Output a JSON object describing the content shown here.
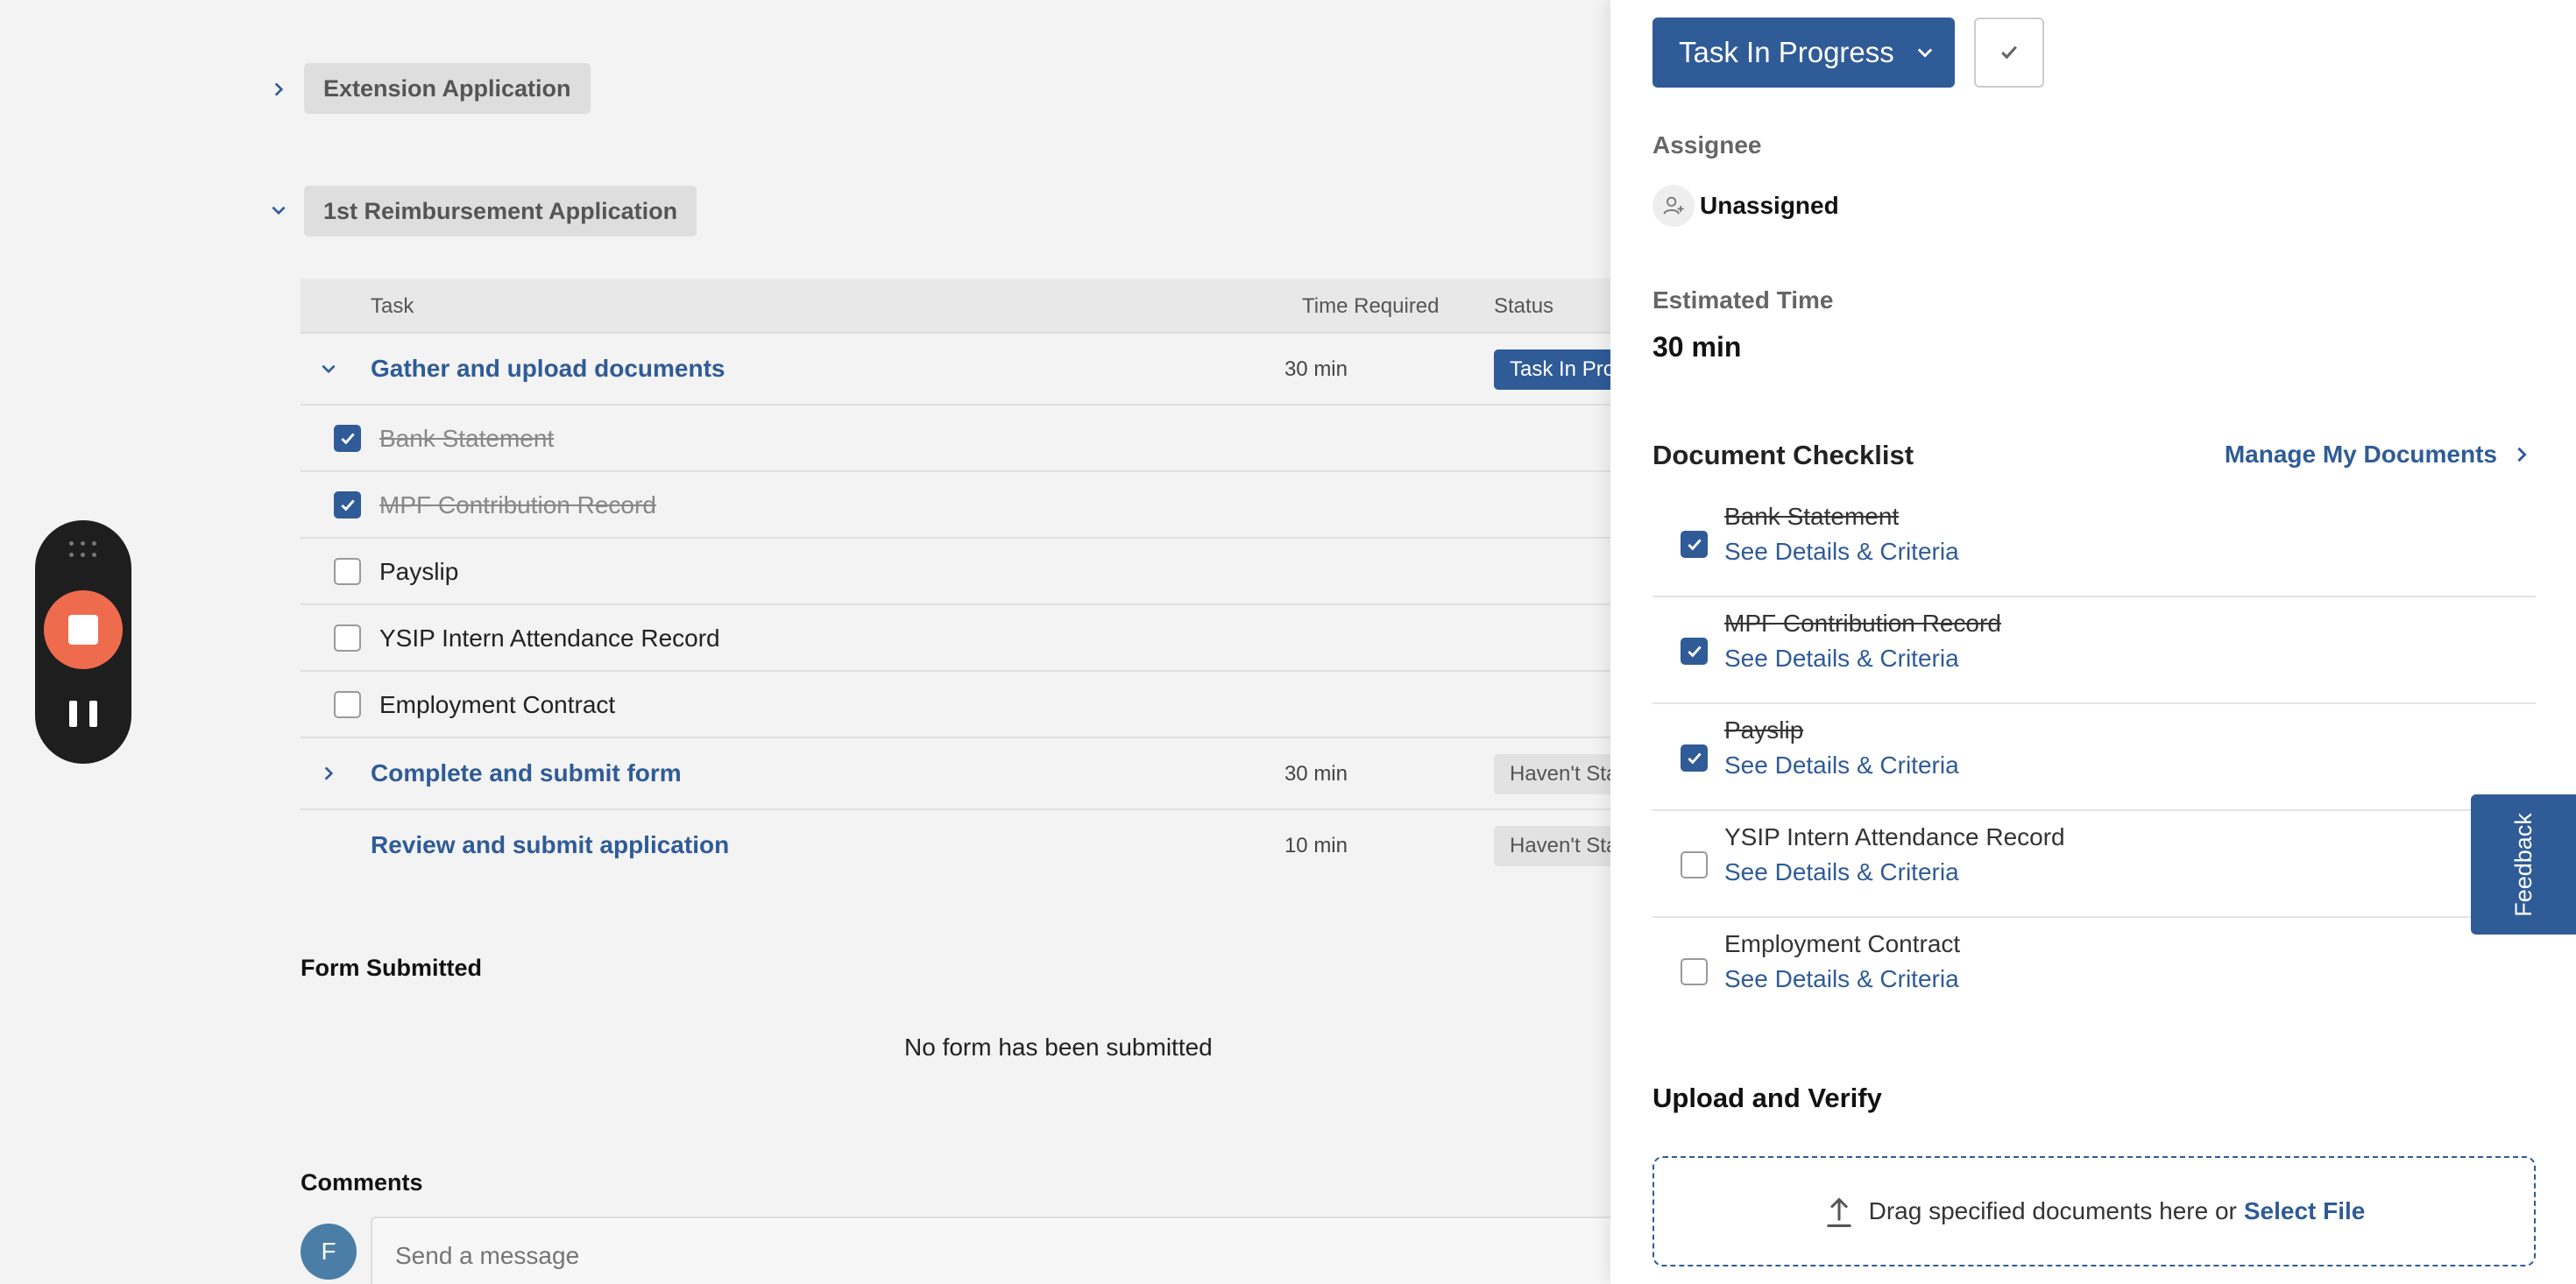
{
  "groups": [
    {
      "label": "Extension Application",
      "expanded": false
    },
    {
      "label": "1st Reimbursement Application",
      "expanded": true
    }
  ],
  "table": {
    "headers": {
      "task": "Task",
      "time": "Time Required",
      "status": "Status"
    },
    "tasks": [
      {
        "name": "Gather and upload documents",
        "time": "30 min",
        "status": "Task In Progress"
      },
      {
        "name": "Complete and submit form",
        "time": "30 min",
        "status": "Haven't Started"
      },
      {
        "name": "Review and submit application",
        "time": "10 min",
        "status": "Haven't Started"
      }
    ],
    "subitems": [
      {
        "label": "Bank Statement",
        "checked": true
      },
      {
        "label": "MPF Contribution Record",
        "checked": true
      },
      {
        "label": "Payslip",
        "checked": false
      },
      {
        "label": "YSIP Intern Attendance Record",
        "checked": false
      },
      {
        "label": "Employment Contract",
        "checked": false
      }
    ]
  },
  "form_section": {
    "title": "Form Submitted",
    "empty": "No form has been submitted"
  },
  "comments": {
    "title": "Comments",
    "avatar": "F",
    "placeholder": "Send a message"
  },
  "panel": {
    "status_button": "Task In Progress",
    "assignee_label": "Assignee",
    "assignee_value": "Unassigned",
    "estimated_label": "Estimated Time",
    "estimated_value": "30 min",
    "checklist_title": "Document Checklist",
    "manage_link": "Manage My Documents",
    "detail_link": "See Details & Criteria",
    "checklist": [
      {
        "label": "Bank Statement",
        "checked": true
      },
      {
        "label": "MPF Contribution Record",
        "checked": true
      },
      {
        "label": "Payslip",
        "checked": true
      },
      {
        "label": "YSIP Intern Attendance Record",
        "checked": false
      },
      {
        "label": "Employment Contract",
        "checked": false
      }
    ],
    "upload_title": "Upload and Verify",
    "drop_text": "Drag specified documents here or",
    "select_file": "Select File"
  },
  "feedback_label": "Feedback",
  "colors": {
    "primary": "#2f5b97",
    "record": "#ef6b4e"
  }
}
